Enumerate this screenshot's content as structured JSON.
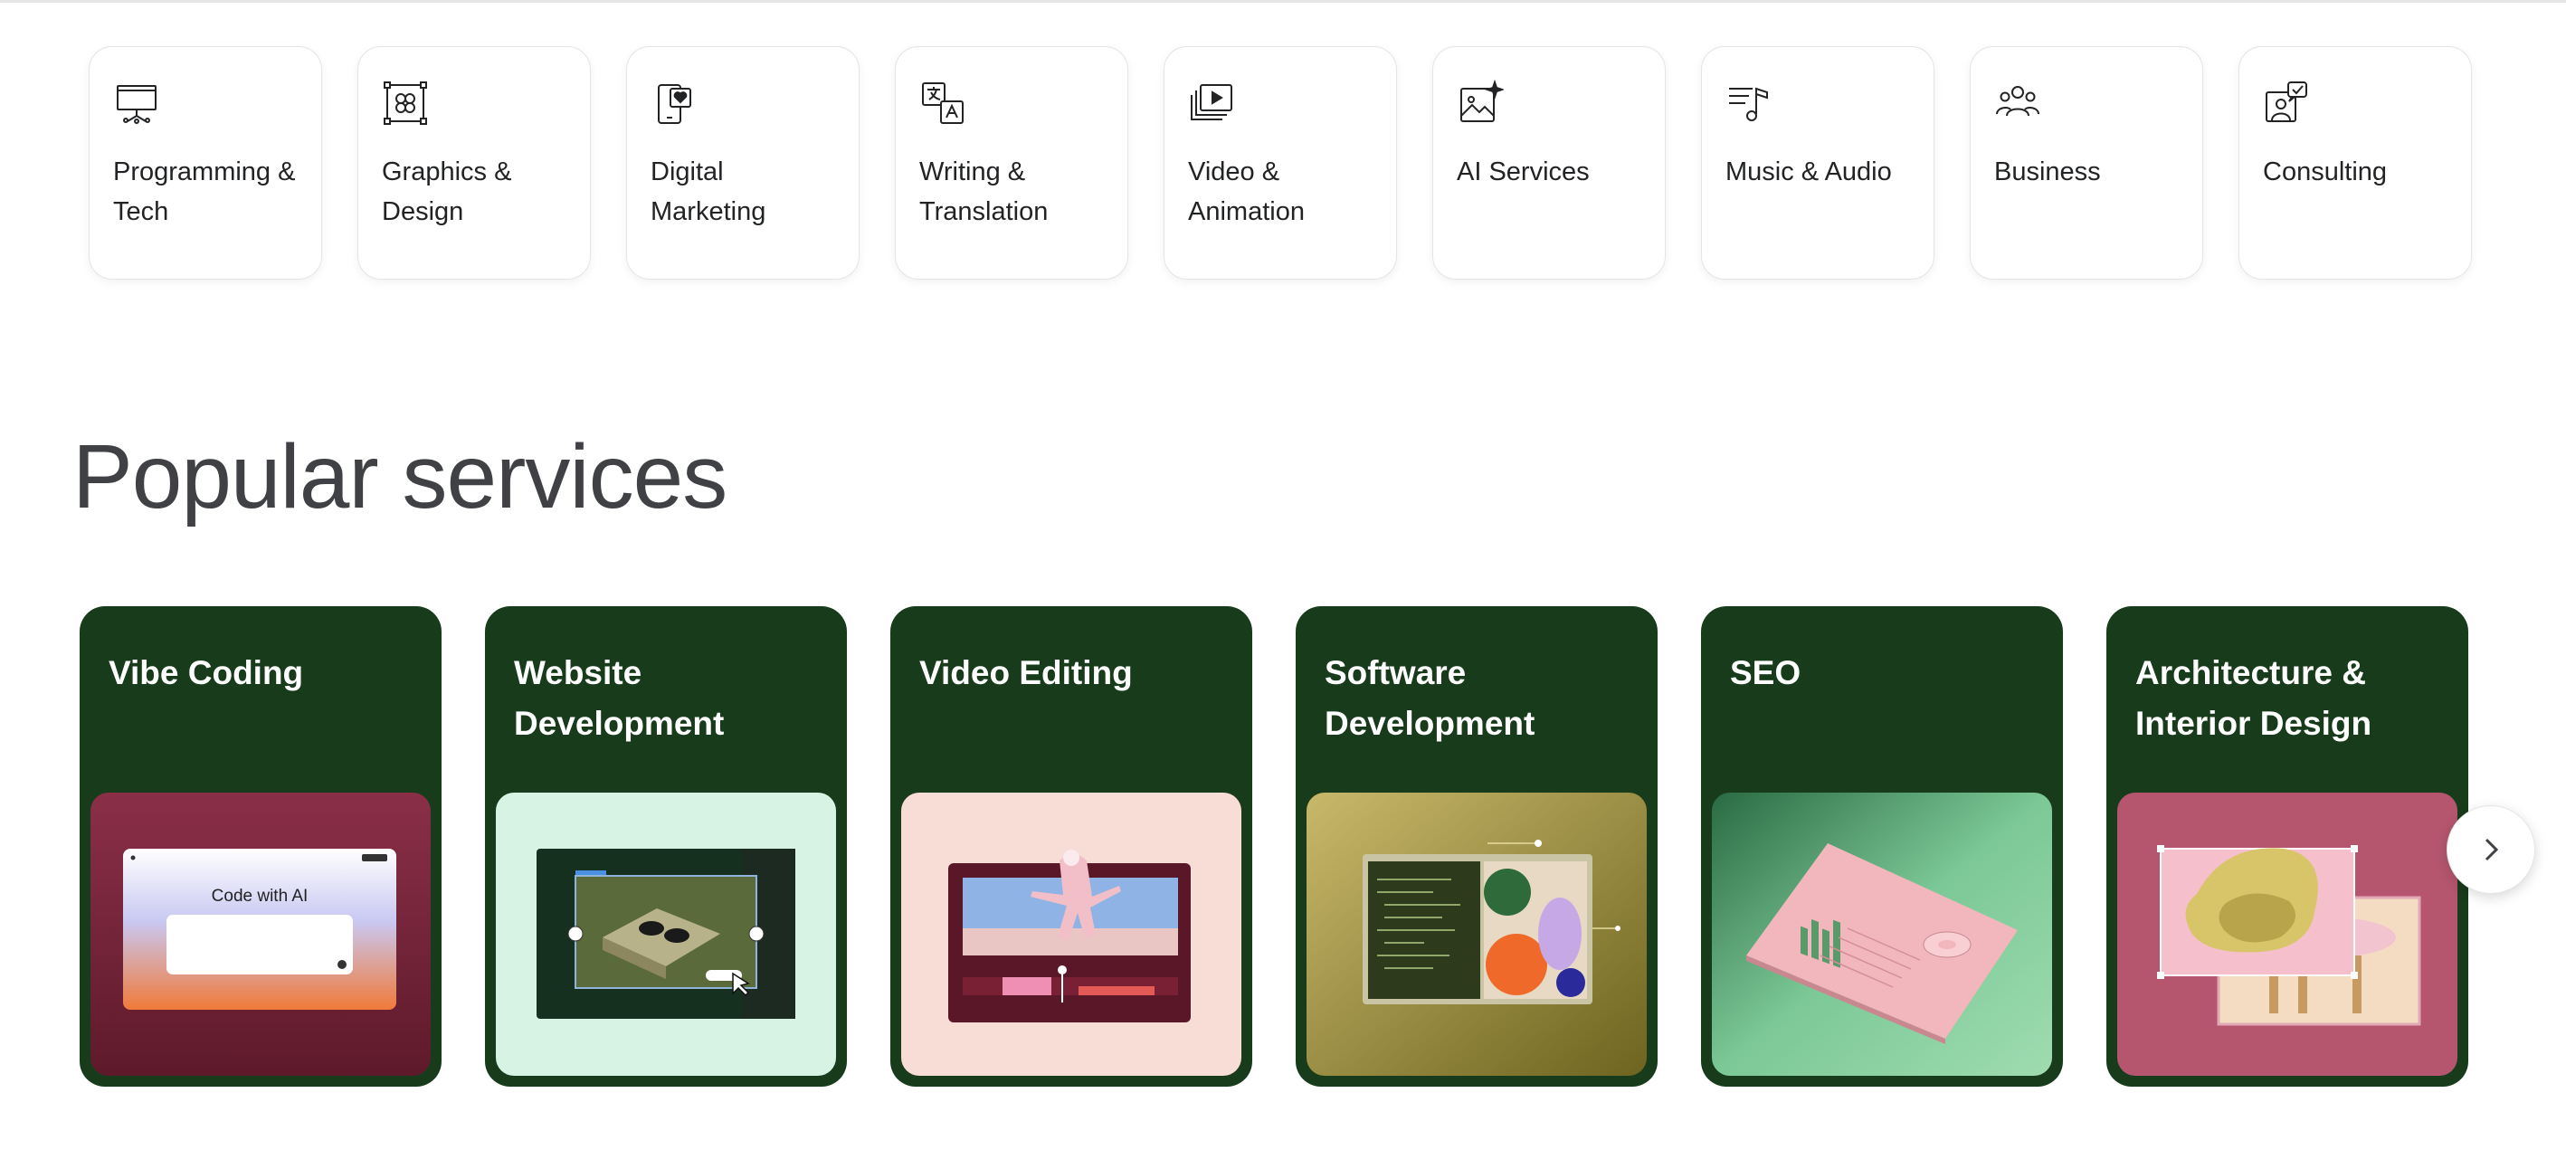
{
  "categories": [
    {
      "label": "Programming & Tech",
      "icon": "presentation-board-icon"
    },
    {
      "label": "Graphics & Design",
      "icon": "design-frame-icon"
    },
    {
      "label": "Digital Marketing",
      "icon": "phone-heart-icon"
    },
    {
      "label": "Writing & Translation",
      "icon": "translate-icon"
    },
    {
      "label": "Video & Animation",
      "icon": "video-play-icon"
    },
    {
      "label": "AI Services",
      "icon": "ai-image-sparkle-icon"
    },
    {
      "label": "Music & Audio",
      "icon": "music-note-icon"
    },
    {
      "label": "Business",
      "icon": "people-group-icon"
    },
    {
      "label": "Consulting",
      "icon": "consulting-chat-icon"
    }
  ],
  "popular": {
    "title": "Popular services",
    "cards": [
      {
        "title": "Vibe Coding",
        "image_text": "Code with AI"
      },
      {
        "title": "Website Development"
      },
      {
        "title": "Video Editing"
      },
      {
        "title": "Software Development"
      },
      {
        "title": "SEO"
      },
      {
        "title": "Architecture & Interior Design"
      }
    ],
    "next_icon": "chevron-right-icon"
  },
  "colors": {
    "card_green": "#183b1b",
    "text_dark": "#222325",
    "heading": "#404145"
  }
}
